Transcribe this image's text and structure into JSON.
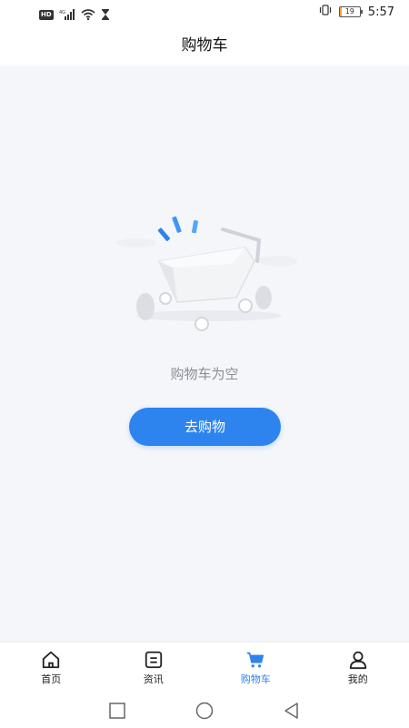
{
  "status_bar": {
    "hd_label": "HD",
    "network_label": "4G",
    "battery_level": "19",
    "time": "5:57"
  },
  "header": {
    "title": "购物车"
  },
  "empty_state": {
    "message": "购物车为空",
    "button_label": "去购物"
  },
  "tabbar": {
    "items": [
      {
        "label": "首页",
        "icon": "home-icon",
        "active": false
      },
      {
        "label": "资讯",
        "icon": "news-icon",
        "active": false
      },
      {
        "label": "购物车",
        "icon": "cart-icon",
        "active": true
      },
      {
        "label": "我的",
        "icon": "user-icon",
        "active": false
      }
    ]
  },
  "colors": {
    "accent": "#2e84ee",
    "background": "#f5f6fa",
    "muted_text": "#8a8d93"
  }
}
